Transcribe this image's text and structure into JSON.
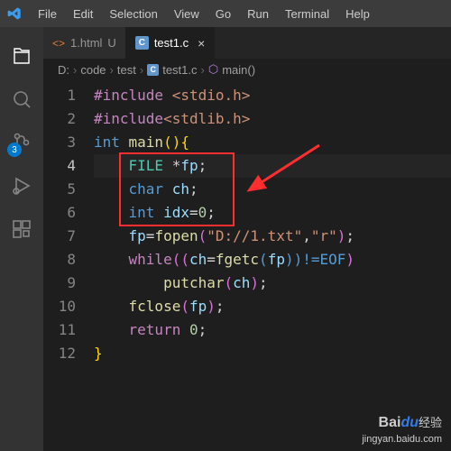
{
  "menus": [
    "File",
    "Edit",
    "Selection",
    "View",
    "Go",
    "Run",
    "Terminal",
    "Help"
  ],
  "activity": {
    "badge": "3"
  },
  "tabs": {
    "inactive": {
      "icon": "<>",
      "name": "1.html",
      "mod": "U"
    },
    "active": {
      "icon": "C",
      "name": "test1.c",
      "close": "×"
    }
  },
  "breadcrumb": {
    "d": "D:",
    "code": "code",
    "test": "test",
    "file": "test1.c",
    "fileicon": "C",
    "func": "main()",
    "sep": "›"
  },
  "gutter": [
    "1",
    "2",
    "3",
    "4",
    "5",
    "6",
    "7",
    "8",
    "9",
    "10",
    "11",
    "12"
  ],
  "currentLine": 4,
  "code": {
    "l1": {
      "a": "#include",
      "b": " <stdio.h>"
    },
    "l2": {
      "a": "#include",
      "b": "<stdlib.h>"
    },
    "l3": {
      "a": "int ",
      "b": "main",
      "c": "()",
      "d": "{"
    },
    "l4": {
      "a": "FILE ",
      "b": "*",
      "c": "fp",
      "d": ";"
    },
    "l5": {
      "a": "char ",
      "b": "ch",
      "c": ";"
    },
    "l6": {
      "a": "int ",
      "b": "idx",
      "c": "=",
      "d": "0",
      "e": ";"
    },
    "l7": {
      "a": "fp",
      "b": "=",
      "c": "fopen",
      "d": "(",
      "e": "\"D://1.txt\"",
      "f": ",",
      "g": "\"r\"",
      "h": ")",
      "i": ";"
    },
    "l8": {
      "a": "while",
      "b": "((",
      "c": "ch",
      "d": "=",
      "e": "fgetc",
      "f": "(",
      "g": "fp",
      "h": "))!=",
      "i": "EOF",
      "j": ")"
    },
    "l9": {
      "a": "putchar",
      "b": "(",
      "c": "ch",
      "d": ")",
      "e": ";"
    },
    "l10": {
      "a": "fclose",
      "b": "(",
      "c": "fp",
      "d": ")",
      "e": ";"
    },
    "l11": {
      "a": "return ",
      "b": "0",
      "c": ";"
    },
    "l12": {
      "a": "}"
    }
  },
  "watermark": {
    "brand_b": "Bai",
    "brand_du": "du",
    "brand_cn": "经验",
    "url": "jingyan.baidu.com"
  }
}
